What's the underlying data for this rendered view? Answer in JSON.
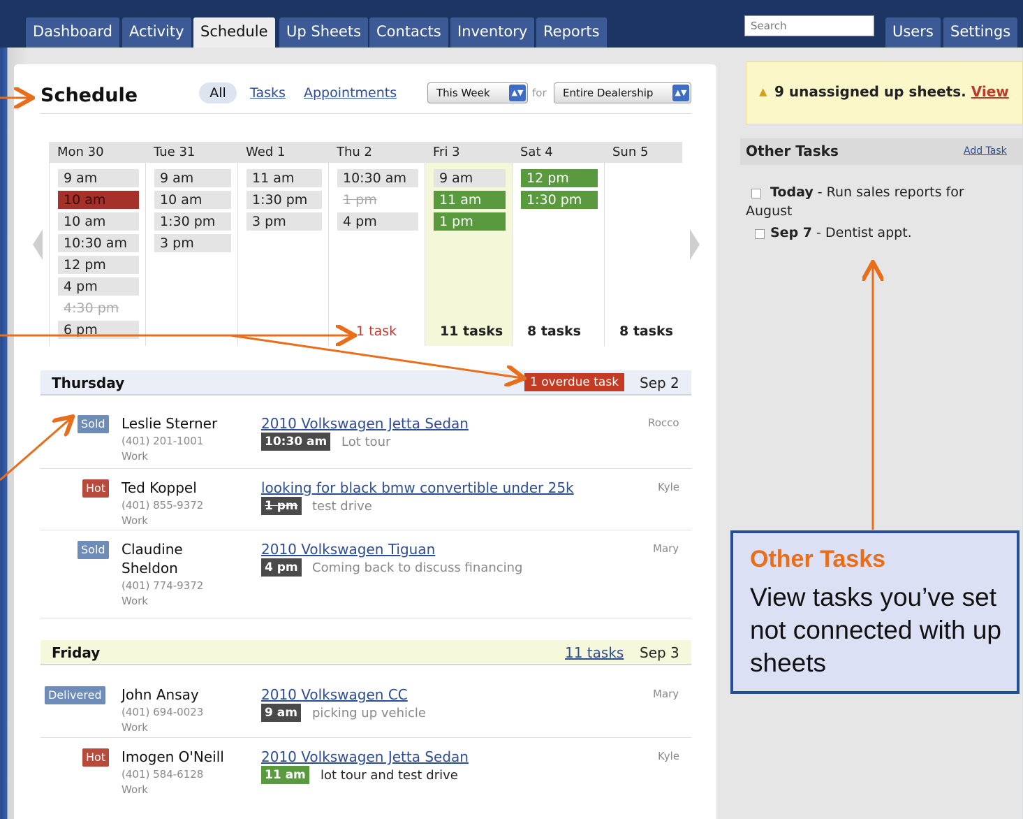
{
  "nav": {
    "tabs": [
      {
        "label": "Dashboard"
      },
      {
        "label": "Activity"
      },
      {
        "label": "Schedule"
      },
      {
        "label": "Up Sheets"
      },
      {
        "label": "Contacts"
      },
      {
        "label": "Inventory"
      },
      {
        "label": "Reports"
      }
    ],
    "search_placeholder": "Search",
    "right": [
      {
        "label": "Users"
      },
      {
        "label": "Settings"
      }
    ]
  },
  "schedule": {
    "title": "Schedule",
    "filters": {
      "all": "All",
      "tasks": "Tasks",
      "appointments": "Appointments"
    },
    "period": "This Week",
    "for_label": "for",
    "scope": "Entire Dealership"
  },
  "calendar": {
    "days": [
      {
        "label": "Mon 30",
        "slots": [
          {
            "t": "9 am"
          },
          {
            "t": "10 am",
            "s": "red"
          },
          {
            "t": "10 am"
          },
          {
            "t": "10:30 am"
          },
          {
            "t": "12 pm"
          },
          {
            "t": "4 pm"
          },
          {
            "t": "4:30 pm",
            "s": "done"
          },
          {
            "t": "6 pm"
          }
        ],
        "count": ""
      },
      {
        "label": "Tue 31",
        "slots": [
          {
            "t": "9 am"
          },
          {
            "t": "10 am"
          },
          {
            "t": "1:30 pm"
          },
          {
            "t": "3 pm"
          }
        ],
        "count": ""
      },
      {
        "label": "Wed 1",
        "slots": [
          {
            "t": "11 am"
          },
          {
            "t": "1:30 pm"
          },
          {
            "t": "3 pm"
          }
        ],
        "count": ""
      },
      {
        "label": "Thu 2",
        "slots": [
          {
            "t": "10:30 am"
          },
          {
            "t": "1 pm",
            "s": "done"
          },
          {
            "t": "4 pm"
          }
        ],
        "count": "1 task"
      },
      {
        "label": "Fri 3",
        "slots": [
          {
            "t": "9 am"
          },
          {
            "t": "11 am",
            "s": "green"
          },
          {
            "t": "1 pm",
            "s": "green"
          }
        ],
        "count": "11 tasks"
      },
      {
        "label": "Sat 4",
        "slots": [
          {
            "t": "12 pm",
            "s": "green"
          },
          {
            "t": "1:30 pm",
            "s": "green"
          }
        ],
        "count": "8 tasks"
      },
      {
        "label": "Sun 5",
        "slots": [],
        "count": "8 tasks"
      }
    ]
  },
  "thursday": {
    "name": "Thursday",
    "overdue": "1 overdue task",
    "date": "Sep 2",
    "entries": [
      {
        "status": "Sold",
        "name1": "Leslie Sterner",
        "name2": "",
        "phone": "(401) 201-1001",
        "phone_type": "Work",
        "vehicle": "2010 Volkswagen Jetta Sedan",
        "time": "10:30 am",
        "note": "Lot tour",
        "owner": "Rocco"
      },
      {
        "status": "Hot",
        "name1": "Ted Koppel",
        "name2": "",
        "phone": "(401) 855-9372",
        "phone_type": "Work",
        "vehicle": "looking for black bmw convertible under 25k",
        "time": "1 pm",
        "note": "test drive",
        "owner": "Kyle"
      },
      {
        "status": "Sold",
        "name1": "Claudine",
        "name2": "Sheldon",
        "phone": "(401) 774-9372",
        "phone_type": "Work",
        "vehicle": "2010 Volkswagen Tiguan",
        "time": "4 pm",
        "note": "Coming back to discuss financing",
        "owner": "Mary"
      }
    ]
  },
  "friday": {
    "name": "Friday",
    "tasks": "11 tasks",
    "date": "Sep 3",
    "entries": [
      {
        "status": "Delivered",
        "name1": "John Ansay",
        "phone": "(401) 694-0023",
        "phone_type": "Work",
        "vehicle": "2010 Volkswagen CC",
        "time": "9 am",
        "note": "picking up vehicle",
        "owner": "Mary"
      },
      {
        "status": "Hot",
        "name1": "Imogen O'Neill",
        "phone": "(401) 584-6128",
        "phone_type": "Work",
        "vehicle": "2010 Volkswagen Jetta Sedan",
        "time": "11 am",
        "note": "lot tour and test drive",
        "owner": "Kyle"
      }
    ]
  },
  "sidebar": {
    "alert_text": "9 unassigned up sheets.",
    "alert_link": "View",
    "other_tasks_title": "Other Tasks",
    "add_task": "Add Task",
    "tasks": [
      {
        "when": "Today",
        "sep": " - ",
        "text": "Run sales reports for",
        "text2": "August"
      },
      {
        "when": "Sep 7",
        "sep": " - ",
        "text": "Dentist appt."
      }
    ]
  },
  "callout": {
    "heading": "Other Tasks",
    "body": "View tasks you’ve set not connected with up sheets"
  },
  "colors": {
    "nav": "#1c3563",
    "tab": "#3c5b96",
    "accent_arrow": "#e86e1c",
    "overdue": "#c23b22",
    "green_slot": "#5a9a3e"
  }
}
